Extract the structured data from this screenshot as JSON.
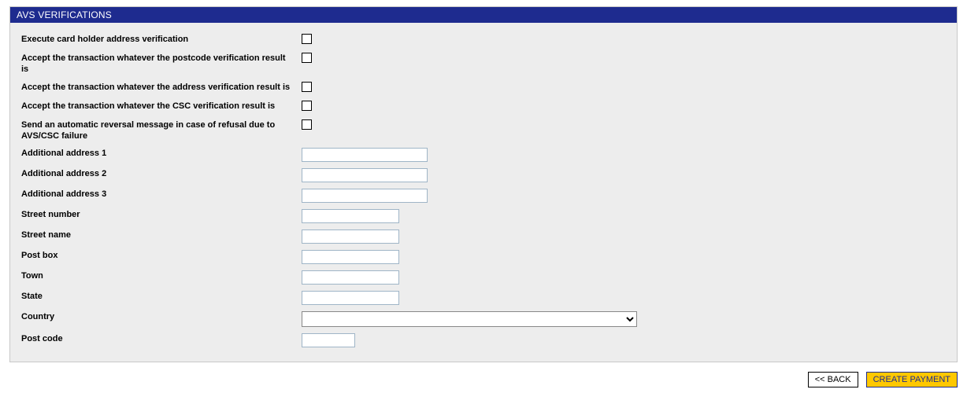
{
  "panel": {
    "title": "AVS VERIFICATIONS"
  },
  "fields": {
    "execute_verification": {
      "label": "Execute card holder address verification"
    },
    "accept_postcode": {
      "label": "Accept the transaction whatever the postcode verification result is"
    },
    "accept_address": {
      "label": "Accept the transaction whatever the address verification result is"
    },
    "accept_csc": {
      "label": "Accept the transaction whatever the CSC verification result is"
    },
    "send_reversal": {
      "label": "Send an automatic reversal message in case of refusal due to AVS/CSC failure"
    },
    "addr1": {
      "label": "Additional address 1",
      "value": ""
    },
    "addr2": {
      "label": "Additional address 2",
      "value": ""
    },
    "addr3": {
      "label": "Additional address 3",
      "value": ""
    },
    "street_number": {
      "label": "Street number",
      "value": ""
    },
    "street_name": {
      "label": "Street name",
      "value": ""
    },
    "post_box": {
      "label": "Post box",
      "value": ""
    },
    "town": {
      "label": "Town",
      "value": ""
    },
    "state": {
      "label": "State",
      "value": ""
    },
    "country": {
      "label": "Country",
      "value": ""
    },
    "post_code": {
      "label": "Post code",
      "value": ""
    }
  },
  "buttons": {
    "back": "<< BACK",
    "create": "CREATE PAYMENT"
  }
}
